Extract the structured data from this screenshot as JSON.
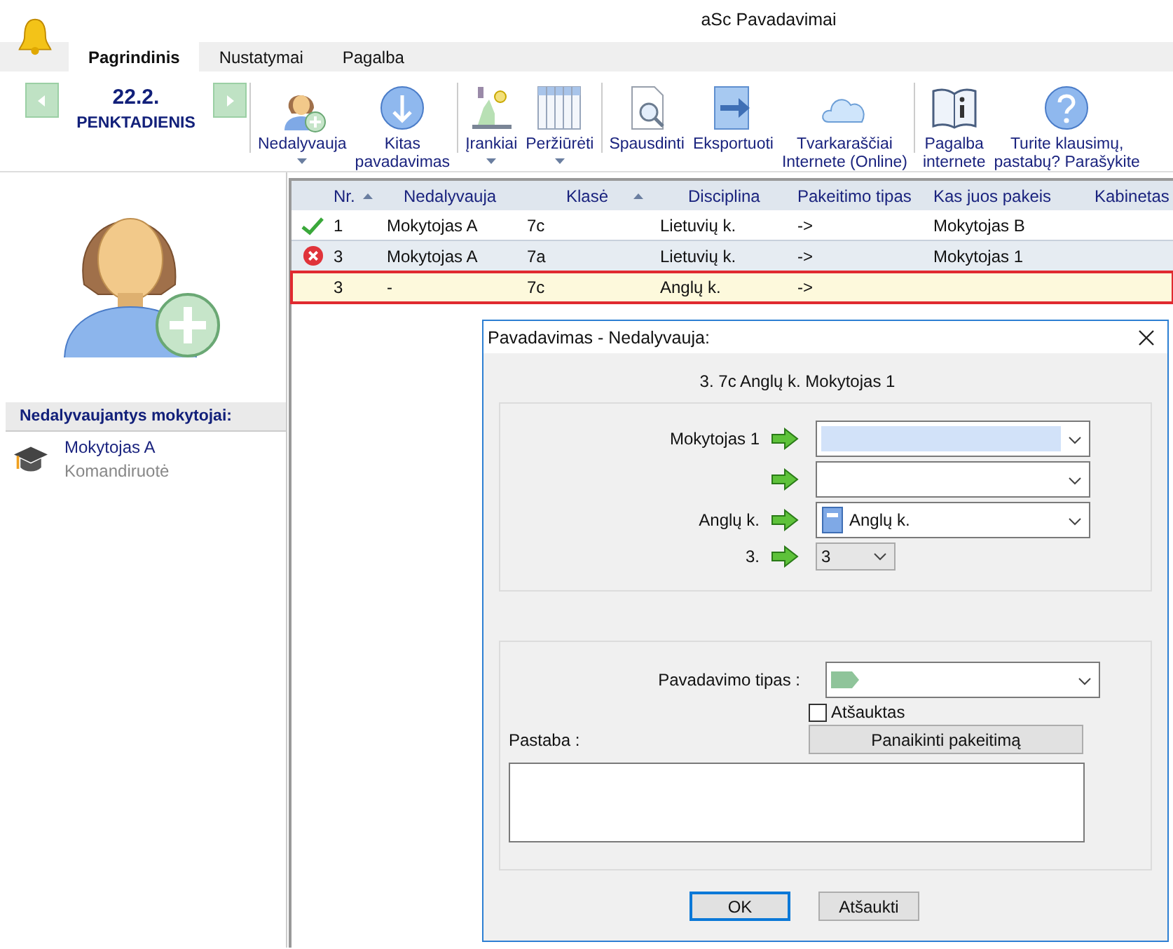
{
  "window": {
    "title": "aSc Pavadavimai"
  },
  "tabs": [
    {
      "label": "Pagrindinis",
      "selected": true
    },
    {
      "label": "Nustatymai",
      "selected": false
    },
    {
      "label": "Pagalba",
      "selected": false
    }
  ],
  "date": {
    "day": "22.2.",
    "weekday": "PENKTADIENIS"
  },
  "toolbar_groups": [
    [
      {
        "kind": "person",
        "lines": [
          "Nedalyvauja"
        ],
        "dropdown": true
      },
      {
        "kind": "down",
        "lines": [
          "Kitas",
          "pavadavimas"
        ],
        "dropdown": false
      }
    ],
    [
      {
        "kind": "tools",
        "lines": [
          "Įrankiai"
        ],
        "dropdown": true
      },
      {
        "kind": "grid",
        "lines": [
          "Peržiūrėti"
        ],
        "dropdown": true
      }
    ],
    [
      {
        "kind": "print",
        "lines": [
          "Spausdinti"
        ],
        "dropdown": false
      },
      {
        "kind": "export",
        "lines": [
          "Eksportuoti"
        ],
        "dropdown": false
      },
      {
        "kind": "cloud",
        "lines": [
          "Tvarkaraščiai",
          "Internete (Online)"
        ],
        "dropdown": false
      }
    ],
    [
      {
        "kind": "book",
        "lines": [
          "Pagalba",
          "internete"
        ],
        "dropdown": false
      },
      {
        "kind": "help",
        "lines": [
          "Turite klausimų,",
          "pastabų? Parašykite"
        ],
        "dropdown": false
      }
    ]
  ],
  "absent_panel": {
    "title": "Nedalyvaujantys mokytojai:",
    "items": [
      {
        "name": "Mokytojas A",
        "reason": "Komandiruotė"
      }
    ]
  },
  "table": {
    "columns": [
      {
        "label": "Nr.",
        "sorted": true
      },
      {
        "label": "Nedalyvauja",
        "sorted": false
      },
      {
        "label": "Klasė",
        "sorted": true
      },
      {
        "label": "Disciplina",
        "sorted": false
      },
      {
        "label": "Pakeitimo tipas",
        "sorted": false
      },
      {
        "label": "Kas juos pakeis",
        "sorted": false
      },
      {
        "label": "Kabinetas",
        "sorted": false
      }
    ],
    "rows": [
      {
        "kind": "ok",
        "selected": false,
        "cells": [
          "1",
          "Mokytojas A",
          "7c",
          "Lietuvių k.",
          "->",
          "Mokytojas B",
          ""
        ]
      },
      {
        "kind": "error",
        "selected": false,
        "cells": [
          "3",
          "Mokytojas A",
          "7a",
          "Lietuvių k.",
          "->",
          "Mokytojas 1",
          ""
        ]
      },
      {
        "kind": "none",
        "selected": true,
        "cells": [
          "3",
          "-",
          "7c",
          "Anglų k.",
          "->",
          "",
          ""
        ]
      }
    ]
  },
  "dialog": {
    "title": "Pavadavimas - Nedalyvauja:",
    "summary": "3. 7c  Anglų k. Mokytojas 1",
    "rows": [
      {
        "label": "Mokytojas 1",
        "kind": "combo",
        "value": "",
        "highlighted": true,
        "book": false
      },
      {
        "label": "",
        "kind": "combo",
        "value": "",
        "highlighted": false,
        "book": false
      },
      {
        "label": "Anglų k.",
        "kind": "combo",
        "value": "Anglų k.",
        "highlighted": false,
        "book": true
      },
      {
        "label": "3.",
        "kind": "small",
        "value": "3",
        "highlighted": false,
        "book": false
      }
    ],
    "type_label": "Pavadavimo tipas :",
    "cancelled": {
      "label": "Atšauktas",
      "checked": false
    },
    "note_label": "Pastaba :",
    "delete_button": "Panaikinti pakeitimą",
    "ok": "OK",
    "cancel": "Atšaukti"
  }
}
